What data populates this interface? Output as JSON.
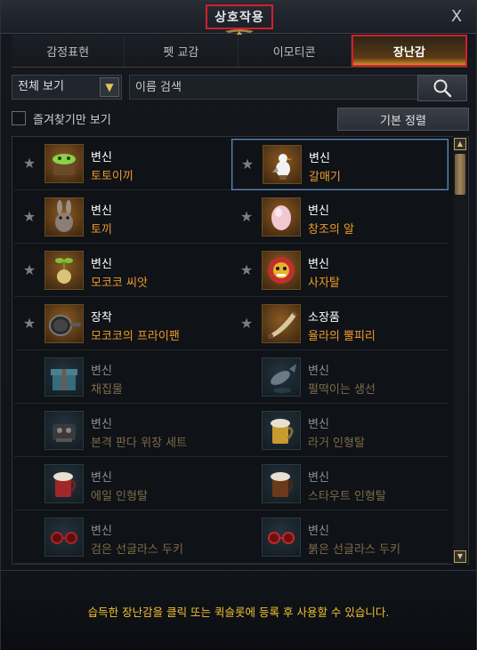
{
  "window": {
    "title": "상호작용",
    "close_label": "X"
  },
  "tabs": [
    {
      "label": "감정표현",
      "active": false
    },
    {
      "label": "펫 교감",
      "active": false
    },
    {
      "label": "이모티콘",
      "active": false
    },
    {
      "label": "장난감",
      "active": true
    }
  ],
  "filter": {
    "view_select_value": "전체 보기",
    "search_placeholder": "이름 검색"
  },
  "favorites": {
    "checkbox_label": "즐겨찾기만 보기",
    "sort_label": "기본 정렬"
  },
  "items": [
    {
      "type": "변신",
      "name": "토토이끼",
      "icon": "totoiki-icon",
      "owned": true,
      "selected": false
    },
    {
      "type": "변신",
      "name": "갈매기",
      "icon": "seagull-icon",
      "owned": true,
      "selected": true
    },
    {
      "type": "변신",
      "name": "토끼",
      "icon": "rabbit-icon",
      "owned": true,
      "selected": false
    },
    {
      "type": "변신",
      "name": "창조의 알",
      "icon": "egg-icon",
      "owned": true,
      "selected": false
    },
    {
      "type": "변신",
      "name": "모코코 씨앗",
      "icon": "mokoko-seed-icon",
      "owned": true,
      "selected": false
    },
    {
      "type": "변신",
      "name": "사자탈",
      "icon": "lion-mask-icon",
      "owned": true,
      "selected": false
    },
    {
      "type": "장착",
      "name": "모코코의 프라이팬",
      "icon": "frying-pan-icon",
      "owned": true,
      "selected": false
    },
    {
      "type": "소장품",
      "name": "율라의 뿔피리",
      "icon": "horn-icon",
      "owned": true,
      "selected": false
    },
    {
      "type": "변신",
      "name": "채집물",
      "icon": "gift-box-icon",
      "owned": false,
      "selected": false
    },
    {
      "type": "변신",
      "name": "펄떡이는 생선",
      "icon": "fish-icon",
      "owned": false,
      "selected": false
    },
    {
      "type": "변신",
      "name": "본격 판다 위장 세트",
      "icon": "panda-disguise-icon",
      "owned": false,
      "selected": false
    },
    {
      "type": "변신",
      "name": "라거 인형탈",
      "icon": "lager-mug-icon",
      "owned": false,
      "selected": false
    },
    {
      "type": "변신",
      "name": "에일 인형탈",
      "icon": "ale-mug-icon",
      "owned": false,
      "selected": false
    },
    {
      "type": "변신",
      "name": "스타우트 인형탈",
      "icon": "stout-mug-icon",
      "owned": false,
      "selected": false
    },
    {
      "type": "변신",
      "name": "검은 선글라스 두키",
      "icon": "black-sunglasses-icon",
      "owned": false,
      "selected": false
    },
    {
      "type": "변신",
      "name": "붉은 선글라스 두키",
      "icon": "red-sunglasses-icon",
      "owned": false,
      "selected": false
    }
  ],
  "footer": {
    "notice": "습득한 장난감을 클릭 또는 퀵슬롯에 등록 후 사용할 수 있습니다."
  }
}
